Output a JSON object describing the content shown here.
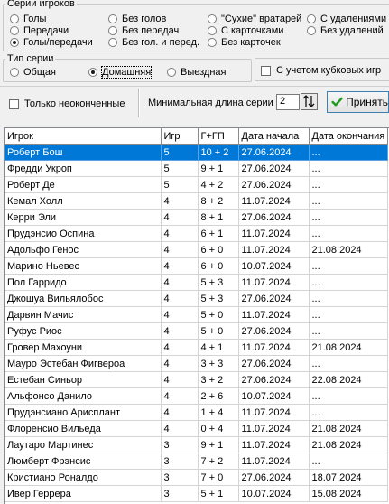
{
  "series_players": {
    "legend": "Серии игроков",
    "options": [
      {
        "label": "Голы",
        "selected": false
      },
      {
        "label": "Передачи",
        "selected": false
      },
      {
        "label": "Голы/передачи",
        "selected": true
      },
      {
        "label": "Без голов",
        "selected": false
      },
      {
        "label": "Без передач",
        "selected": false
      },
      {
        "label": "Без гол. и перед.",
        "selected": false
      },
      {
        "label": "\"Сухие\" вратарей",
        "selected": false
      },
      {
        "label": "С карточками",
        "selected": false
      },
      {
        "label": "Без карточек",
        "selected": false
      },
      {
        "label": "С удалениями",
        "selected": false
      },
      {
        "label": "Без удалений",
        "selected": false
      }
    ]
  },
  "series_type": {
    "legend": "Тип серии",
    "options": [
      {
        "label": "Общая",
        "selected": false
      },
      {
        "label": "Домашняя",
        "selected": true
      },
      {
        "label": "Выездная",
        "selected": false
      }
    ]
  },
  "cup_games": {
    "label": "С учетом кубковых игр",
    "checked": false
  },
  "unfinished": {
    "label": "Только неоконченные",
    "checked": false
  },
  "min_length": {
    "label": "Минимальная длина серии",
    "value": "2"
  },
  "accept_button": {
    "label": "Принять"
  },
  "table": {
    "columns": [
      "Игрок",
      "Игр",
      "Г+ГП",
      "Дата начала",
      "Дата окончания"
    ],
    "selected_row": 0,
    "rows": [
      [
        "Роберт Бош",
        "5",
        "10 + 2",
        "27.06.2024",
        "..."
      ],
      [
        "Фредди Укроп",
        "5",
        "9 + 1",
        "27.06.2024",
        "..."
      ],
      [
        "Роберт Де",
        "5",
        "4 + 2",
        "27.06.2024",
        "..."
      ],
      [
        "Кемал Холл",
        "4",
        "8 + 2",
        "11.07.2024",
        "..."
      ],
      [
        "Керри Эли",
        "4",
        "8 + 1",
        "27.06.2024",
        "..."
      ],
      [
        "Прудэнсио Оспина",
        "4",
        "6 + 1",
        "11.07.2024",
        "..."
      ],
      [
        "Адольфо Генос",
        "4",
        "6 + 0",
        "11.07.2024",
        "21.08.2024"
      ],
      [
        "Марино Ньевес",
        "4",
        "6 + 0",
        "10.07.2024",
        "..."
      ],
      [
        "Пол Гарридо",
        "4",
        "5 + 3",
        "11.07.2024",
        "..."
      ],
      [
        "Джошуа Вильялобос",
        "4",
        "5 + 3",
        "27.06.2024",
        "..."
      ],
      [
        "Дарвин Мачис",
        "4",
        "5 + 0",
        "11.07.2024",
        "..."
      ],
      [
        "Руфус Риос",
        "4",
        "5 + 0",
        "27.06.2024",
        "..."
      ],
      [
        "Гровер Махоуни",
        "4",
        "4 + 1",
        "11.07.2024",
        "21.08.2024"
      ],
      [
        "Мауро Эстебан Фигвероа",
        "4",
        "3 + 3",
        "27.06.2024",
        "..."
      ],
      [
        "Естебан Синьор",
        "4",
        "3 + 2",
        "27.06.2024",
        "22.08.2024"
      ],
      [
        "Альфонсо Данило",
        "4",
        "2 + 6",
        "10.07.2024",
        "..."
      ],
      [
        "Прудэнсиано Арисплант",
        "4",
        "1 + 4",
        "11.07.2024",
        "..."
      ],
      [
        "Флоренсио Вильеда",
        "4",
        "0 + 4",
        "11.07.2024",
        "21.08.2024"
      ],
      [
        "Лаутаро Мартинес",
        "3",
        "9 + 1",
        "11.07.2024",
        "21.08.2024"
      ],
      [
        "Люмберт Фрэнсис",
        "3",
        "7 + 2",
        "11.07.2024",
        "..."
      ],
      [
        "Кристиано Роналдо",
        "3",
        "7 + 0",
        "27.06.2024",
        "18.07.2024"
      ],
      [
        "Ивер Геррера",
        "3",
        "5 + 1",
        "10.07.2024",
        "15.08.2024"
      ]
    ]
  }
}
